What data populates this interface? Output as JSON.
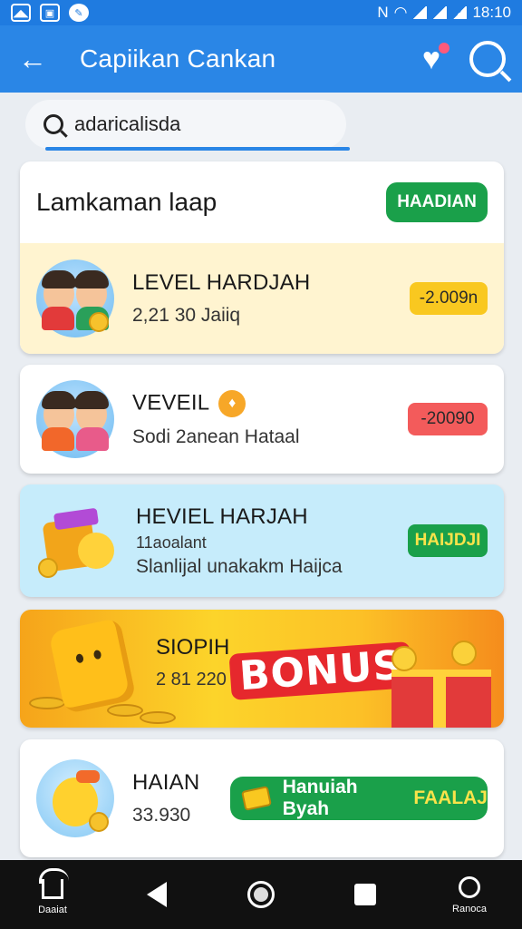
{
  "status_bar": {
    "time": "18:10"
  },
  "app_bar": {
    "title": "Capiikan Cankan"
  },
  "search": {
    "value": "adaricalisda"
  },
  "section": {
    "title": "Lamkaman laap",
    "badge": "HAADIAN"
  },
  "rows": [
    {
      "title": "LEVEL HARDJAH",
      "sub": "2,21 30 Jaiiq",
      "value": "-2.009n"
    },
    {
      "title": "VEVEIL",
      "sub": "Sodi 2anean Hataal",
      "value": "-20090"
    },
    {
      "title": "HEVIEL HARJAH",
      "sub_small": "11aoalant",
      "sub": "Slanlijal unakakm Haijca",
      "value": "HAIJDJI"
    }
  ],
  "bonus": {
    "title": "SIOPIH",
    "sub": "2 81 220",
    "word": "BONUS"
  },
  "reward": {
    "title": "HAIAN",
    "sub": "33.930",
    "button_main": "Hanuiah Byah",
    "button_accent": "FAALAJ"
  },
  "bottom_nav": {
    "home_label": "Daaiat",
    "profile_label": "Ranoca"
  },
  "colors": {
    "primary": "#2a86e6",
    "green": "#1aa04a",
    "yellow_row": "#fff4d0",
    "blue_row": "#c6ecfb",
    "red_badge": "#f35b5b"
  }
}
